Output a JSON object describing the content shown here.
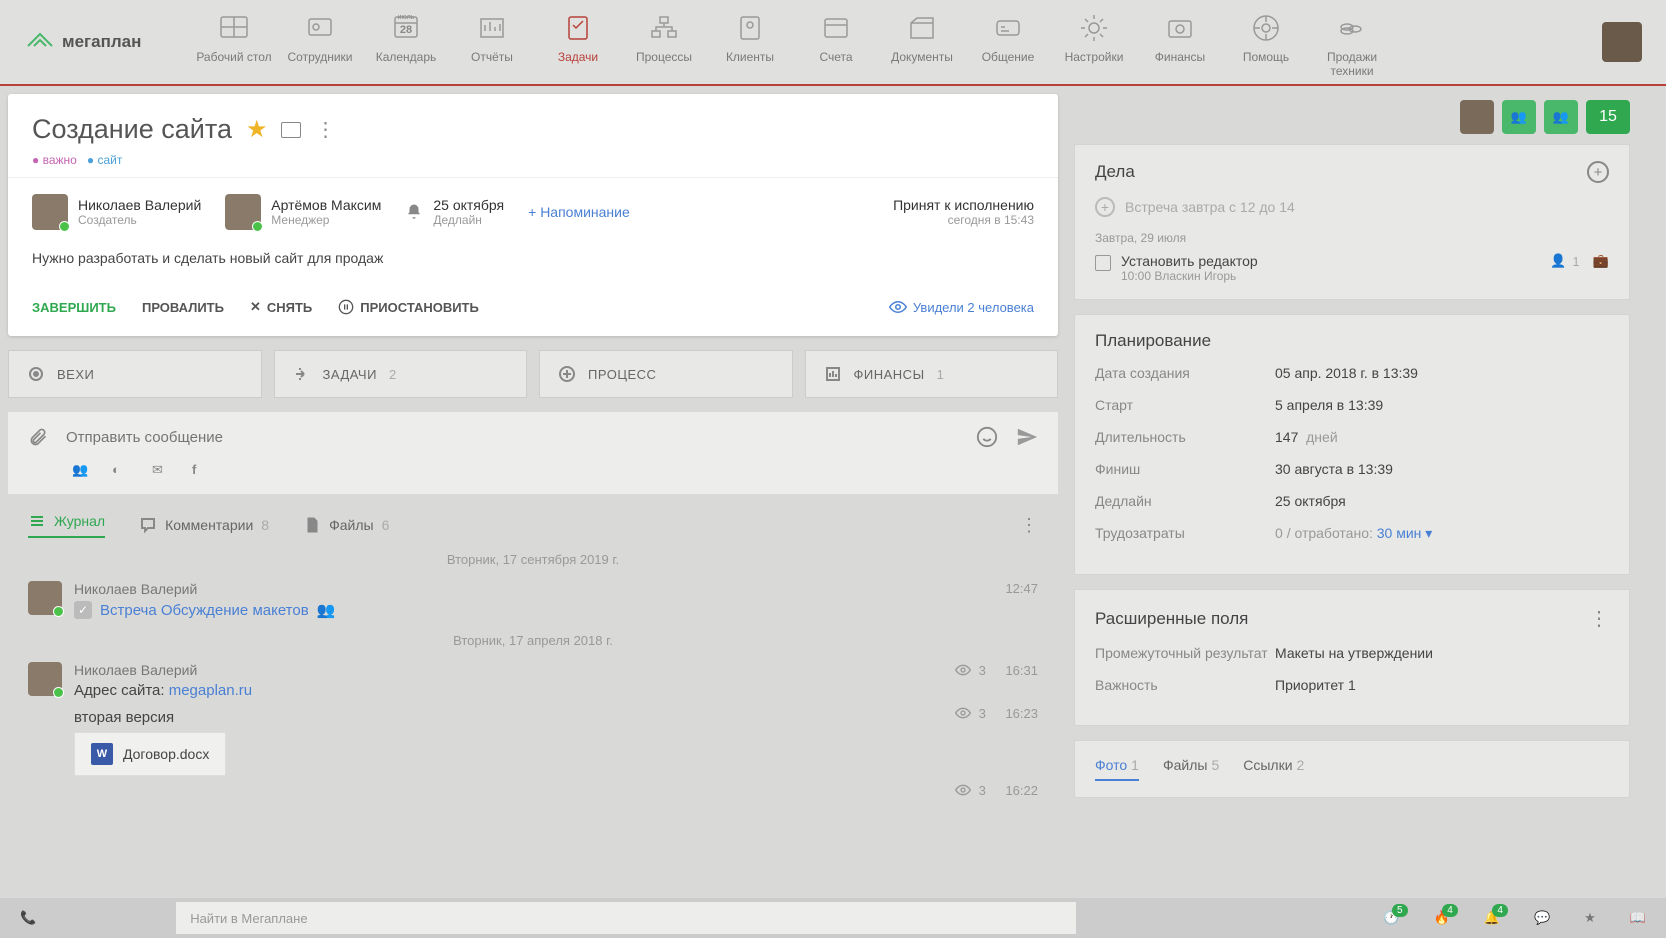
{
  "logo": "мегаплан",
  "nav": [
    {
      "label": "Рабочий стол"
    },
    {
      "label": "Сотрудники"
    },
    {
      "label": "Календарь",
      "badge": "28",
      "sub": "июль"
    },
    {
      "label": "Отчёты"
    },
    {
      "label": "Задачи",
      "active": true
    },
    {
      "label": "Процессы"
    },
    {
      "label": "Клиенты"
    },
    {
      "label": "Счета"
    },
    {
      "label": "Документы"
    },
    {
      "label": "Общение"
    },
    {
      "label": "Настройки"
    },
    {
      "label": "Финансы"
    },
    {
      "label": "Помощь"
    },
    {
      "label": "Продажи техники"
    }
  ],
  "rightHead": {
    "count": "15"
  },
  "task": {
    "title": "Создание сайта",
    "tags": [
      {
        "t": "важно",
        "c": "tag-pink"
      },
      {
        "t": "сайт",
        "c": "tag-blue"
      }
    ],
    "creator": {
      "name": "Николаев Валерий",
      "role": "Создатель"
    },
    "manager": {
      "name": "Артёмов Максим",
      "role": "Менеджер"
    },
    "deadline": {
      "date": "25 октября",
      "label": "Дедлайн"
    },
    "reminder": "+ Напоминание",
    "status": {
      "main": "Принят к исполнению",
      "sub": "сегодня в 15:43"
    },
    "description": "Нужно разработать и сделать новый сайт для продаж",
    "actions": {
      "complete": "ЗАВЕРШИТЬ",
      "fail": "ПРОВАЛИТЬ",
      "remove": "СНЯТЬ",
      "pause": "ПРИОСТАНОВИТЬ"
    },
    "seen": "Увидели 2 человека"
  },
  "tabs4": [
    {
      "l": "ВЕХИ"
    },
    {
      "l": "ЗАДАЧИ",
      "c": "2"
    },
    {
      "l": "ПРОЦЕСС"
    },
    {
      "l": "ФИНАНСЫ",
      "c": "1"
    }
  ],
  "compose": {
    "placeholder": "Отправить сообщение"
  },
  "feedTabs": [
    {
      "l": "Журнал",
      "active": true
    },
    {
      "l": "Комментарии",
      "c": "8"
    },
    {
      "l": "Файлы",
      "c": "6"
    }
  ],
  "feed": {
    "date1": "Вторник, 17 сентября 2019 г.",
    "msg1": {
      "name": "Николаев Валерий",
      "time": "12:47",
      "meeting": "Встреча Обсуждение макетов"
    },
    "date2": "Вторник, 17 апреля 2018 г.",
    "msg2": {
      "name": "Николаев Валерий",
      "views": "3",
      "time": "16:31",
      "text": "Адрес сайта: ",
      "link": "megaplan.ru"
    },
    "msg3": {
      "text": "вторая версия",
      "views": "3",
      "time": "16:23",
      "file": "Договор.docx"
    },
    "msg4": {
      "views": "3",
      "time": "16:22"
    }
  },
  "dela": {
    "title": "Дела",
    "quick": "Встреча завтра с 12 до 14",
    "dateLabel": "Завтра, 29 июля",
    "todo": {
      "title": "Установить редактор",
      "sub": "10:00   Власкин Игорь",
      "count": "1"
    }
  },
  "planning": {
    "title": "Планирование",
    "rows": [
      {
        "k": "Дата создания",
        "v": "05 апр. 2018 г. в 13:39"
      },
      {
        "k": "Старт",
        "v": "5 апреля в 13:39"
      },
      {
        "k": "Длительность",
        "v": "147",
        "unit": "дней"
      },
      {
        "k": "Финиш",
        "v": "30 августа в 13:39"
      },
      {
        "k": "Дедлайн",
        "v": "25 октября"
      }
    ],
    "effort": {
      "k": "Трудозатраты",
      "pre": "0",
      "mid": "/ отработано:",
      "link": "30 мин"
    }
  },
  "ext": {
    "title": "Расширенные поля",
    "rows": [
      {
        "k": "Промежуточный результат",
        "v": "Макеты на утверждении"
      },
      {
        "k": "Важность",
        "v": "Приоритет 1"
      }
    ]
  },
  "attachTabs": [
    {
      "l": "Фото",
      "c": "1",
      "active": true
    },
    {
      "l": "Файлы",
      "c": "5"
    },
    {
      "l": "Ссылки",
      "c": "2"
    }
  ],
  "statusbar": {
    "search": "Найти в Мегаплане",
    "badges": {
      "clock": "5",
      "fire": "4",
      "bell": "4"
    }
  }
}
